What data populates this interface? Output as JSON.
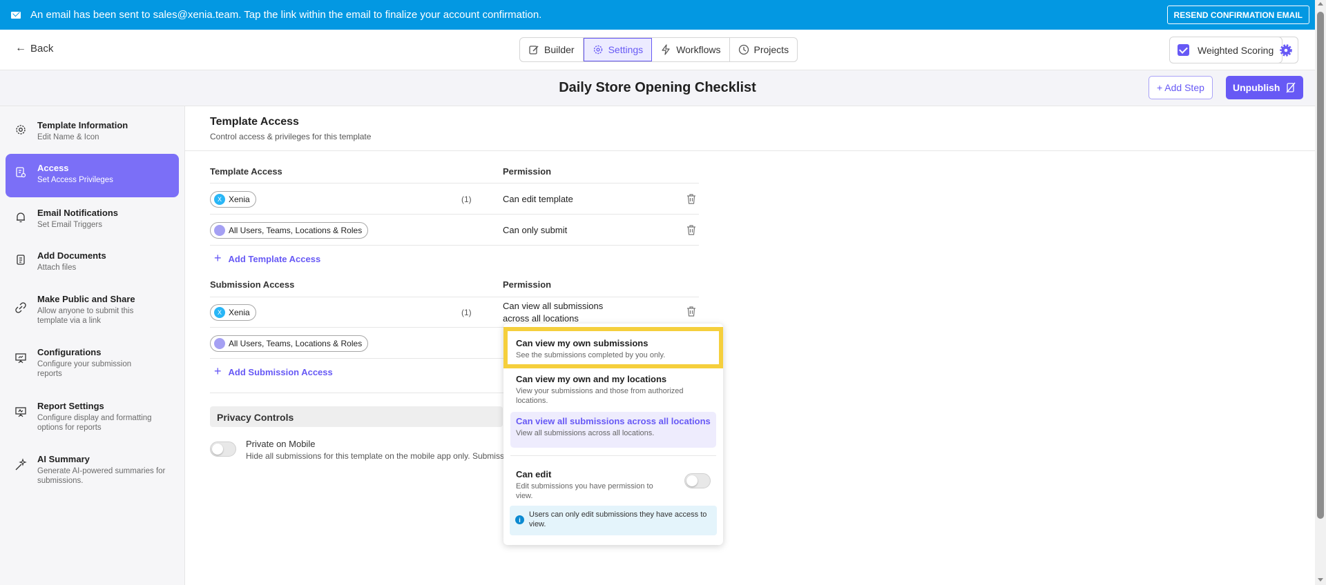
{
  "banner": {
    "message": "An email has been sent to sales@xenia.team. Tap the link within the email to finalize your account confirmation.",
    "resend_label": "RESEND CONFIRMATION EMAIL"
  },
  "topbar": {
    "back_label": "Back",
    "tabs": [
      {
        "label": "Builder",
        "icon": "pencil-icon"
      },
      {
        "label": "Settings",
        "icon": "gear-icon",
        "active": true
      },
      {
        "label": "Workflows",
        "icon": "bolt-icon"
      },
      {
        "label": "Projects",
        "icon": "clock-icon"
      }
    ],
    "weighted_scoring_label": "Weighted Scoring",
    "weighted_scoring_checked": true
  },
  "titlebar": {
    "title": "Daily Store Opening Checklist",
    "add_step_label": "+ Add Step",
    "unpublish_label": "Unpublish"
  },
  "sidebar": {
    "items": [
      {
        "title": "Template Information",
        "subtitle": "Edit Name & Icon",
        "icon": "gear-icon"
      },
      {
        "title": "Access",
        "subtitle": "Set Access Privileges",
        "icon": "document-lock-icon",
        "active": true
      },
      {
        "title": "Email Notifications",
        "subtitle": "Set Email Triggers",
        "icon": "bell-icon"
      },
      {
        "title": "Add Documents",
        "subtitle": "Attach files",
        "icon": "documents-icon"
      },
      {
        "title": "Make Public and Share",
        "subtitle": "Allow anyone to submit this template via a link",
        "icon": "link-icon"
      },
      {
        "title": "Configurations",
        "subtitle": "Configure your submission reports",
        "icon": "presentation-icon"
      },
      {
        "title": "Report Settings",
        "subtitle": "Configure display and formatting options for reports",
        "icon": "report-icon"
      },
      {
        "title": "AI Summary",
        "subtitle": "Generate AI-powered summaries for submissions.",
        "icon": "sparkle-icon"
      }
    ]
  },
  "main": {
    "heading": "Template Access",
    "subheading": "Control access & privileges for this template",
    "template_access": {
      "col_access": "Template Access",
      "col_permission": "Permission",
      "rows": [
        {
          "chip": "Xenia",
          "count": "(1)",
          "permission": "Can edit template"
        },
        {
          "chip": "All Users, Teams, Locations & Roles",
          "count": "",
          "permission": "Can only submit"
        }
      ],
      "add_label": "Add Template Access"
    },
    "submission_access": {
      "col_access": "Submission Access",
      "col_permission": "Permission",
      "rows": [
        {
          "chip": "Xenia",
          "count": "(1)",
          "permission": "Can view all submissions across all locations"
        },
        {
          "chip": "All Users, Teams, Locations & Roles",
          "count": "",
          "permission": ""
        }
      ],
      "add_label": "Add Submission Access"
    },
    "privacy": {
      "heading": "Privacy Controls",
      "mobile_title": "Private on Mobile",
      "mobile_desc": "Hide all submissions for this template on the mobile app only. Submissions will still be visible on web."
    }
  },
  "dropdown": {
    "options": [
      {
        "title": "Can view my own submissions",
        "desc": "See the submissions completed by you only."
      },
      {
        "title": "Can view my own and my locations",
        "desc": "View your submissions and those from authorized locations."
      },
      {
        "title": "Can view all submissions across all locations",
        "desc": "View all submissions across all locations.",
        "selected": true
      }
    ],
    "can_edit_title": "Can edit",
    "can_edit_desc": "Edit submissions you have permission to view.",
    "info": "Users can only edit submissions they have access to view."
  },
  "colors": {
    "banner": "#0398e2",
    "accent": "#6759f5",
    "highlight": "#f5cf3c"
  }
}
